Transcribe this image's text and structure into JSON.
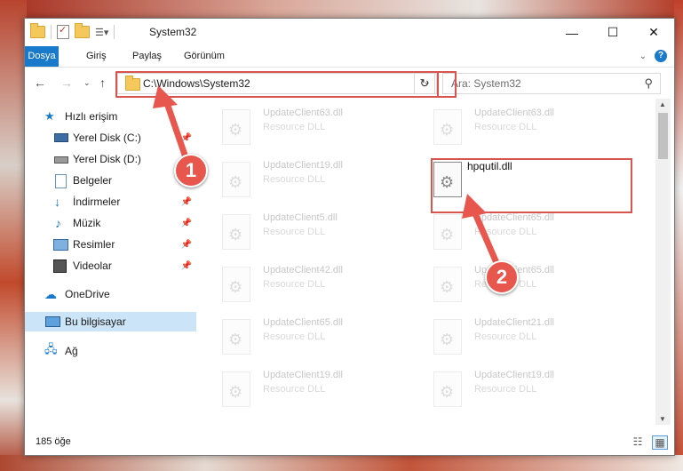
{
  "window": {
    "title": "System32"
  },
  "ribbon": {
    "tabs": [
      "Dosya",
      "Giriş",
      "Paylaş",
      "Görünüm"
    ]
  },
  "navbar": {
    "address": "C:\\Windows\\System32",
    "search_placeholder": "Ara: System32"
  },
  "sidebar": {
    "items": [
      {
        "label": "Hızlı erişim",
        "icon": "star-icon",
        "pinned": false
      },
      {
        "label": "Yerel Disk (C:)",
        "icon": "drive-icon",
        "pinned": true
      },
      {
        "label": "Yerel Disk (D:)",
        "icon": "drive-icon",
        "pinned": false
      },
      {
        "label": "Belgeler",
        "icon": "documents-icon",
        "pinned": true
      },
      {
        "label": "İndirmeler",
        "icon": "download-icon",
        "pinned": true
      },
      {
        "label": "Müzik",
        "icon": "music-icon",
        "pinned": true
      },
      {
        "label": "Resimler",
        "icon": "pictures-icon",
        "pinned": true
      },
      {
        "label": "Videolar",
        "icon": "video-icon",
        "pinned": true
      },
      {
        "label": "OneDrive",
        "icon": "cloud-icon",
        "pinned": false
      },
      {
        "label": "Bu bilgisayar",
        "icon": "computer-icon",
        "pinned": false,
        "selected": true
      },
      {
        "label": "Ağ",
        "icon": "network-icon",
        "pinned": false
      }
    ]
  },
  "files": [
    {
      "name": "UpdateClient63.dll",
      "type": "Resource DLL"
    },
    {
      "name": "UpdateClient63.dll",
      "type": "Resource DLL"
    },
    {
      "name": "UpdateClient19.dll",
      "type": "Resource DLL"
    },
    {
      "name": "hpqutil.dll",
      "type": ""
    },
    {
      "name": "UpdateClient5.dll",
      "type": "Resource DLL"
    },
    {
      "name": "UpdateClient65.dll",
      "type": "Resource DLL"
    },
    {
      "name": "UpdateClient42.dll",
      "type": "Resource DLL"
    },
    {
      "name": "UpdateClient65.dll",
      "type": "Resource DLL"
    },
    {
      "name": "UpdateClient65.dll",
      "type": "Resource DLL"
    },
    {
      "name": "UpdateClient21.dll",
      "type": "Resource DLL"
    },
    {
      "name": "UpdateClient19.dll",
      "type": "Resource DLL"
    },
    {
      "name": "UpdateClient19.dll",
      "type": "Resource DLL"
    }
  ],
  "status": {
    "count": "185 öğe"
  },
  "annotations": {
    "badge1": "1",
    "badge2": "2",
    "color": "#e8574d"
  }
}
